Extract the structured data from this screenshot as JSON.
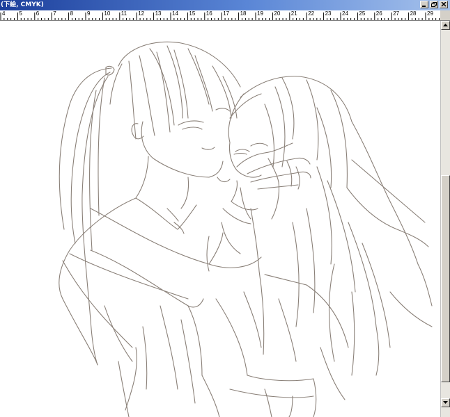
{
  "window": {
    "title": "(下絵, CMYK)",
    "buttons": [
      "minimize",
      "restore",
      "close"
    ]
  },
  "ruler": {
    "labels": [
      "4",
      "5",
      "6",
      "7",
      "8",
      "9",
      "10",
      "11",
      "12",
      "13",
      "14",
      "15",
      "16",
      "17",
      "18",
      "19",
      "20",
      "21",
      "22",
      "23",
      "24",
      "25",
      "26",
      "27",
      "28",
      "29"
    ]
  },
  "canvas": {
    "content": "pencil-line-drawing",
    "line_color": "#8a8078",
    "background": "#ffffff"
  },
  "scrollbar": {
    "orientation": "vertical",
    "icons": [
      "scroll-up-arrow-icon",
      "scroll-down-arrow-icon"
    ]
  },
  "colors": {
    "titlebar_start": "#1c3f9c",
    "titlebar_end": "#a6c2ec",
    "chrome": "#d4d0c8"
  }
}
